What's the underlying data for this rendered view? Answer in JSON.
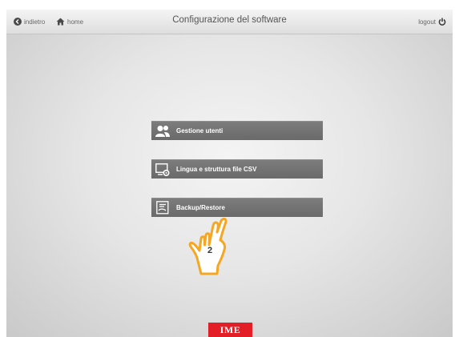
{
  "header": {
    "back_label": "indietro",
    "home_label": "home",
    "title": "Configurazione del software",
    "logout_label": "logout"
  },
  "menu": {
    "items": [
      {
        "label": "Gestione utenti",
        "icon": "users-icon"
      },
      {
        "label": "Lingua e struttura file CSV",
        "icon": "language-csv-icon"
      },
      {
        "label": "Backup/Restore",
        "icon": "backup-restore-icon"
      }
    ]
  },
  "pointer": {
    "step": "2",
    "icon": "pointing-hand-icon"
  },
  "footer": {
    "logo_text": "IME",
    "logo_color": "#e41e26"
  },
  "colors": {
    "button": "#737373",
    "background": "#e6e6e6",
    "hand_outline": "#f5a623"
  }
}
